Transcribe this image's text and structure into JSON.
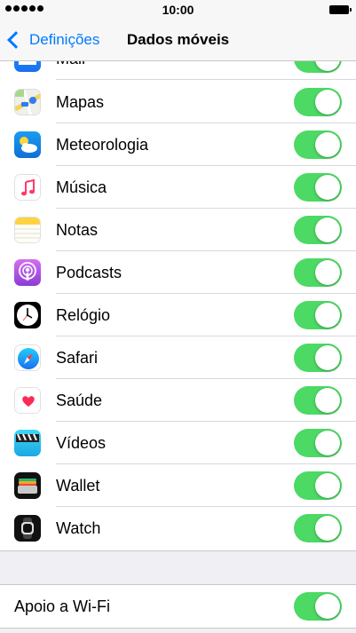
{
  "status": {
    "time": "10:00"
  },
  "nav": {
    "back_label": "Definições",
    "title": "Dados móveis"
  },
  "apps": [
    {
      "label": "Mail",
      "icon": "mail-icon",
      "enabled": true
    },
    {
      "label": "Mapas",
      "icon": "maps-icon",
      "enabled": true
    },
    {
      "label": "Meteorologia",
      "icon": "weather-icon",
      "enabled": true
    },
    {
      "label": "Música",
      "icon": "music-icon",
      "enabled": true
    },
    {
      "label": "Notas",
      "icon": "notes-icon",
      "enabled": true
    },
    {
      "label": "Podcasts",
      "icon": "podcasts-icon",
      "enabled": true
    },
    {
      "label": "Relógio",
      "icon": "clock-icon",
      "enabled": true
    },
    {
      "label": "Safari",
      "icon": "safari-icon",
      "enabled": true
    },
    {
      "label": "Saúde",
      "icon": "health-icon",
      "enabled": true
    },
    {
      "label": "Vídeos",
      "icon": "videos-icon",
      "enabled": true
    },
    {
      "label": "Wallet",
      "icon": "wallet-icon",
      "enabled": true
    },
    {
      "label": "Watch",
      "icon": "watch-icon",
      "enabled": true
    }
  ],
  "wifi_assist": {
    "label": "Apoio a Wi-Fi",
    "enabled": true
  },
  "colors": {
    "accent": "#007aff",
    "toggle_on": "#4cd964",
    "background": "#efeff4"
  }
}
